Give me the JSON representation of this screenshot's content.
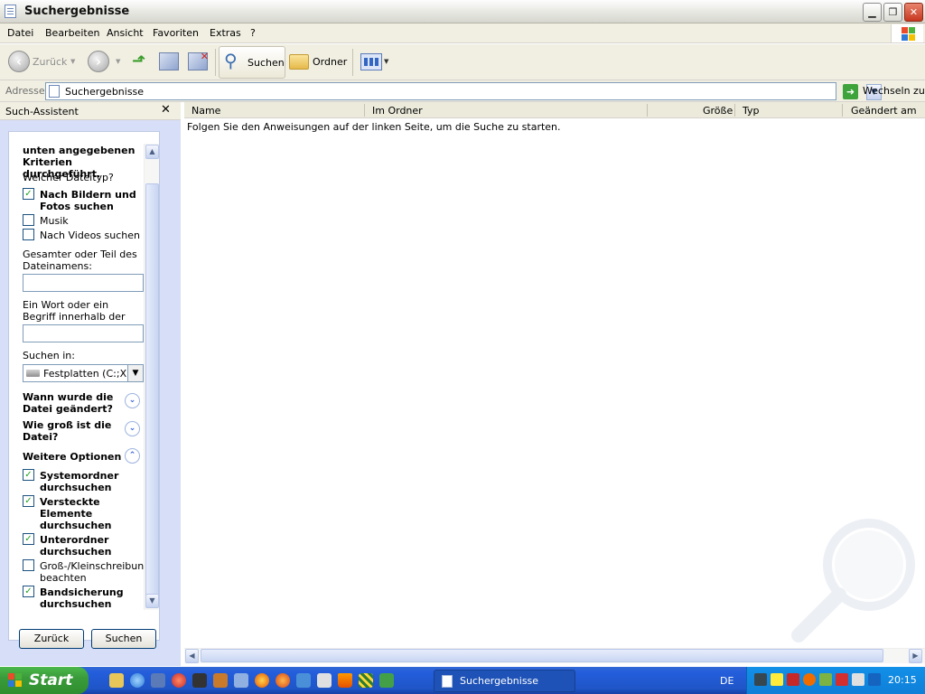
{
  "window": {
    "title": "Suchergebnisse"
  },
  "menu": [
    "Datei",
    "Bearbeiten",
    "Ansicht",
    "Favoriten",
    "Extras",
    "?"
  ],
  "toolbar": {
    "back": "Zurück",
    "search": "Suchen",
    "folders": "Ordner"
  },
  "address": {
    "label": "Adresse",
    "value": "Suchergebnisse",
    "go": "Wechseln zu"
  },
  "assistant": {
    "title": "Such-Assistent",
    "heading": "unten angegebenen Kriterien durchgeführt.",
    "filetype_question": "Welcher Dateityp?",
    "filetypes": [
      {
        "label": "Nach Bildern und Fotos suchen",
        "checked": true
      },
      {
        "label": "Musik",
        "checked": false
      },
      {
        "label": "Nach Videos suchen",
        "checked": false
      }
    ],
    "filename_label": "Gesamter oder Teil des Dateinamens:",
    "filename_value": "",
    "word_label": "Ein Wort oder ein Begriff innerhalb der Datei:",
    "word_value": "",
    "lookin_label": "Suchen in:",
    "lookin_value": "Festplatten (C:;X:)",
    "when_modified": "Wann wurde die Datei geändert?",
    "size_question": "Wie groß ist die Datei?",
    "more_options": "Weitere Optionen",
    "options": [
      {
        "label": "Systemordner durchsuchen",
        "checked": true
      },
      {
        "label": "Versteckte Elemente durchsuchen",
        "checked": true
      },
      {
        "label": "Unterordner durchsuchen",
        "checked": true
      },
      {
        "label": "Groß-/Kleinschreibung beachten",
        "checked": false
      },
      {
        "label": "Bandsicherung durchsuchen",
        "checked": true
      }
    ],
    "back_button": "Zurück",
    "search_button": "Suchen"
  },
  "results": {
    "columns": [
      "Name",
      "Im Ordner",
      "Größe",
      "Typ",
      "Geändert am"
    ],
    "message": "Folgen Sie den Anweisungen auf der linken Seite, um die Suche zu starten."
  },
  "taskbar": {
    "start": "Start",
    "task": "Suchergebnisse",
    "lang": "DE",
    "clock": "20:15"
  }
}
